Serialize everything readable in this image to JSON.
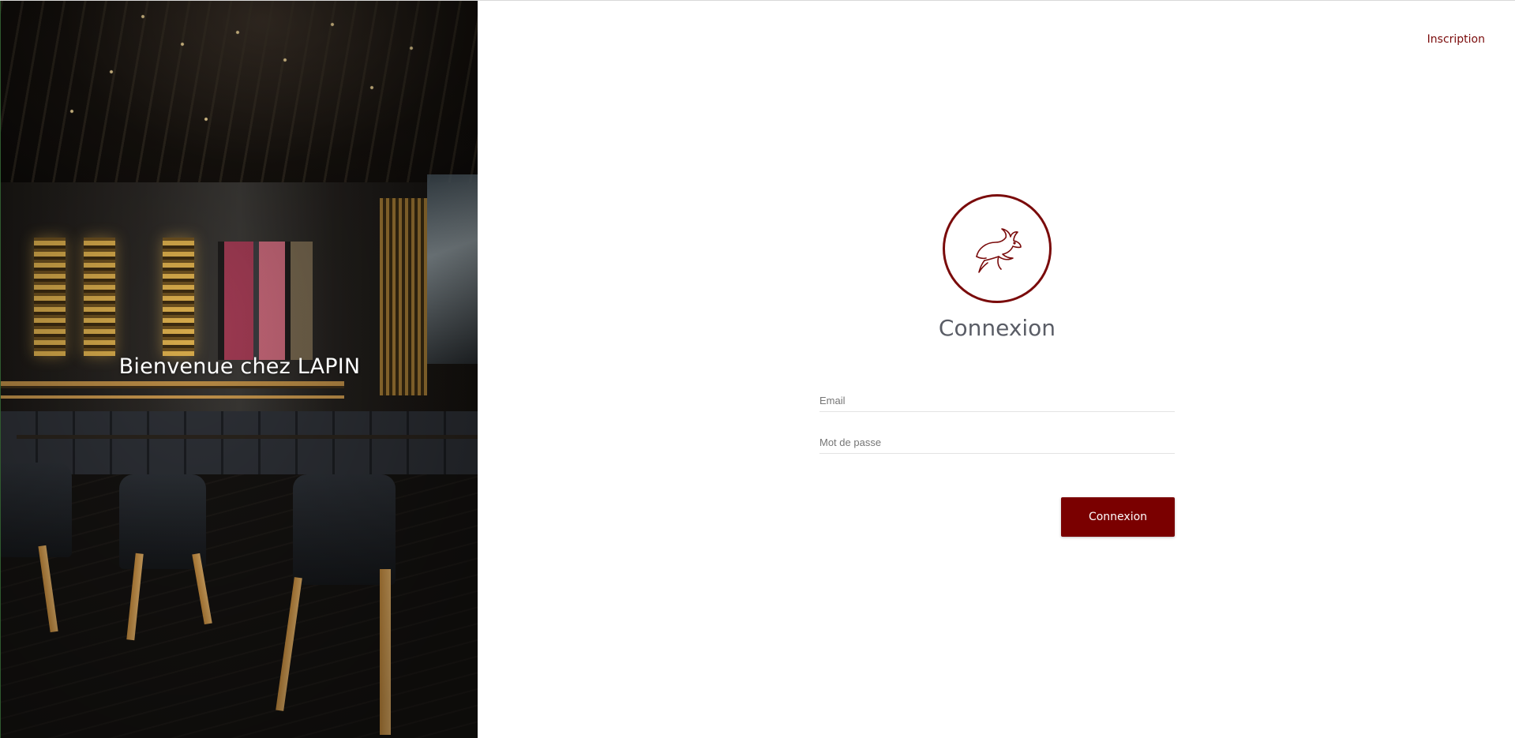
{
  "hero": {
    "title": "Bienvenue chez LAPIN",
    "image": "restaurant-interior-photo"
  },
  "header": {
    "signup_link": "Inscription"
  },
  "login": {
    "logo_icon": "rabbit-icon",
    "title": "Connexion",
    "email_placeholder": "Email",
    "password_placeholder": "Mot de passe",
    "submit_label": "Connexion"
  },
  "colors": {
    "accent": "#7a0000",
    "title_text": "#5a5d66"
  }
}
